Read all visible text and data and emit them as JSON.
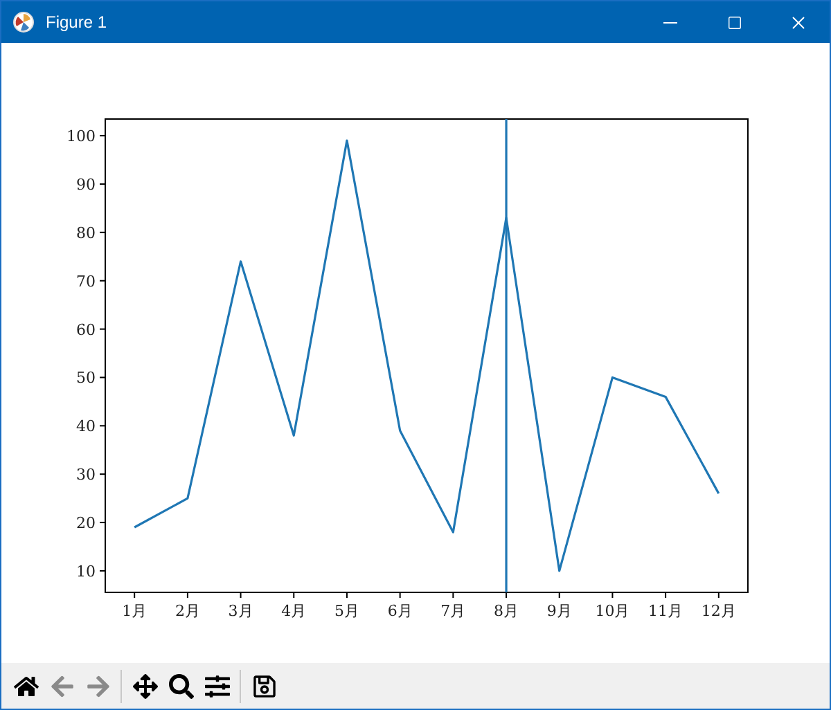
{
  "window": {
    "title": "Figure 1"
  },
  "figure": {
    "chart_data": {
      "type": "line",
      "categories": [
        "1月",
        "2月",
        "3月",
        "4月",
        "5月",
        "6月",
        "7月",
        "8月",
        "9月",
        "10月",
        "11月",
        "12月"
      ],
      "series": [
        {
          "color": "#1f77b4",
          "values": [
            19,
            25,
            74,
            38,
            99,
            39,
            18,
            83,
            10,
            50,
            46,
            26
          ]
        }
      ],
      "ylim": [
        5.55,
        103.45
      ],
      "yticks": [
        10,
        20,
        30,
        40,
        50,
        60,
        70,
        80,
        90,
        100
      ],
      "ref_lines": [
        {
          "axis": "x",
          "value": "8月",
          "color": "#1f77b4"
        }
      ]
    }
  },
  "toolbar": [
    {
      "kind": "home",
      "disabled": false
    },
    {
      "kind": "back",
      "disabled": true
    },
    {
      "kind": "forward",
      "disabled": true
    },
    {
      "kind": "separator"
    },
    {
      "kind": "pan",
      "disabled": false
    },
    {
      "kind": "zoom",
      "disabled": false
    },
    {
      "kind": "configure",
      "disabled": false
    },
    {
      "kind": "separator"
    },
    {
      "kind": "save",
      "disabled": false
    }
  ]
}
